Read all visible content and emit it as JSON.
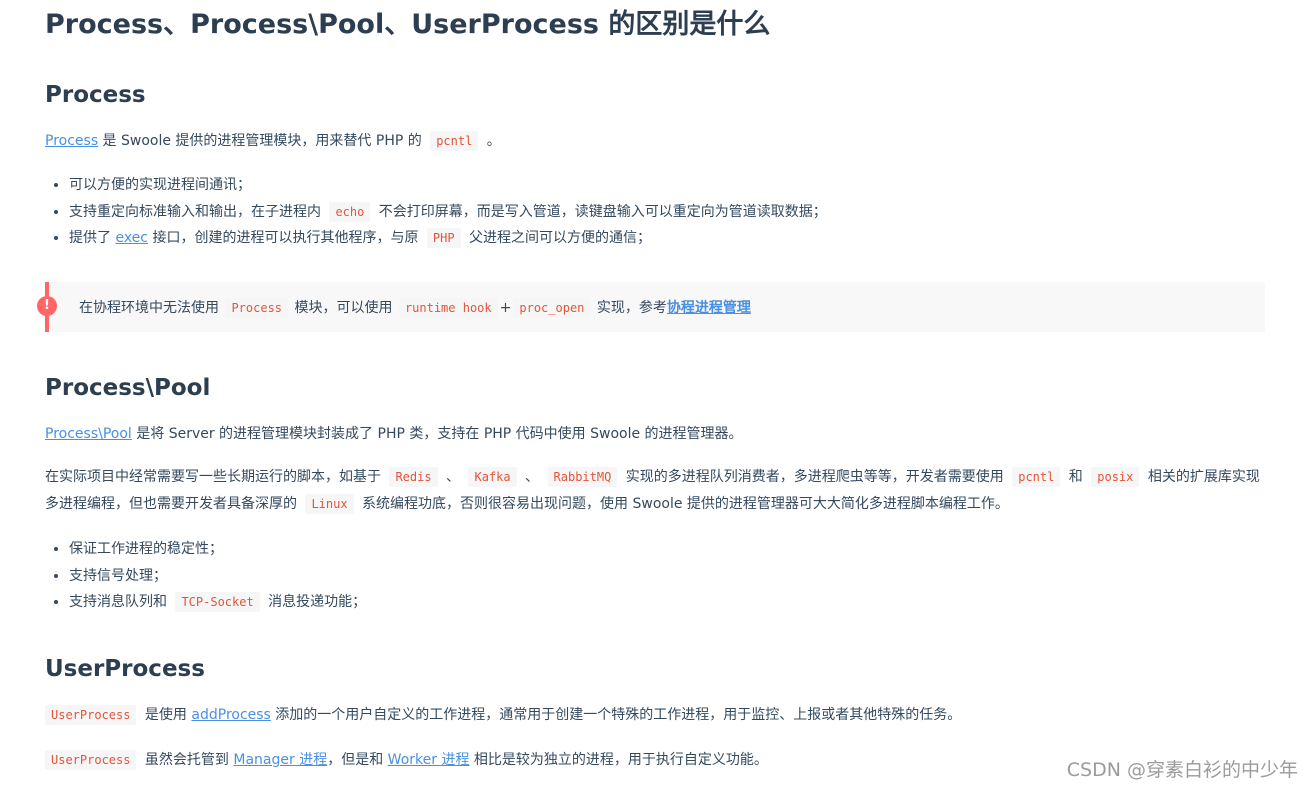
{
  "title": "Process、Process\\Pool、UserProcess 的区别是什么",
  "process": {
    "heading": "Process",
    "intro": {
      "link": "Process",
      "t1": " 是 Swoole 提供的进程管理模块，用来替代 PHP 的 ",
      "code": "pcntl",
      "t2": " 。"
    },
    "bullets": {
      "b1": "可以方便的实现进程间通讯；",
      "b2_t1": "支持重定向标准输入和输出，在子进程内 ",
      "b2_code": "echo",
      "b2_t2": " 不会打印屏幕，而是写入管道，读键盘输入可以重定向为管道读取数据；",
      "b3_t1": "提供了 ",
      "b3_link": "exec",
      "b3_t2": " 接口，创建的进程可以执行其他程序，与原 ",
      "b3_code": "PHP",
      "b3_t3": " 父进程之间可以方便的通信；"
    },
    "tip": {
      "icon": "!",
      "t1": "在协程环境中无法使用 ",
      "code1": "Process",
      "t2": " 模块，可以使用 ",
      "code2": "runtime hook",
      "plus": "+",
      "code3": "proc_open",
      "t3": " 实现，参考",
      "link": "协程进程管理"
    }
  },
  "pool": {
    "heading": "Process\\Pool",
    "intro": {
      "link": "Process\\Pool",
      "t1": " 是将 Server 的进程管理模块封装成了 PHP 类，支持在 PHP 代码中使用 Swoole 的进程管理器。"
    },
    "para": {
      "t1": "在实际项目中经常需要写一些长期运行的脚本，如基于 ",
      "c1": "Redis",
      "s1": " 、 ",
      "c2": "Kafka",
      "s2": " 、 ",
      "c3": "RabbitMQ",
      "t2": " 实现的多进程队列消费者，多进程爬虫等等，开发者需要使用 ",
      "c4": "pcntl",
      "t3": " 和 ",
      "c5": "posix",
      "t4": " 相关的扩展库实现多进程编程，但也需要开发者具备深厚的 ",
      "c6": "Linux",
      "t5": " 系统编程功底，否则很容易出现问题，使用 Swoole 提供的进程管理器可大大简化多进程脚本编程工作。"
    },
    "bullets": {
      "b1": "保证工作进程的稳定性；",
      "b2": "支持信号处理；",
      "b3_t1": "支持消息队列和 ",
      "b3_code": "TCP-Socket",
      "b3_t2": " 消息投递功能；"
    }
  },
  "user": {
    "heading": "UserProcess",
    "p1": {
      "code": "UserProcess",
      "t1": " 是使用 ",
      "link": "addProcess",
      "t2": " 添加的一个用户自定义的工作进程，通常用于创建一个特殊的工作进程，用于监控、上报或者其他特殊的任务。"
    },
    "p2": {
      "code": "UserProcess",
      "t1": " 虽然会托管到 ",
      "link1": "Manager 进程",
      "t2": "，但是和 ",
      "link2": "Worker 进程",
      "t3": " 相比是较为独立的进程，用于执行自定义功能。"
    }
  },
  "watermark": "CSDN @穿素白衫的中少年",
  "colors": {
    "accent_link": "#4a90e2",
    "code_text": "#e4543a",
    "tip_border": "#ff6666"
  }
}
